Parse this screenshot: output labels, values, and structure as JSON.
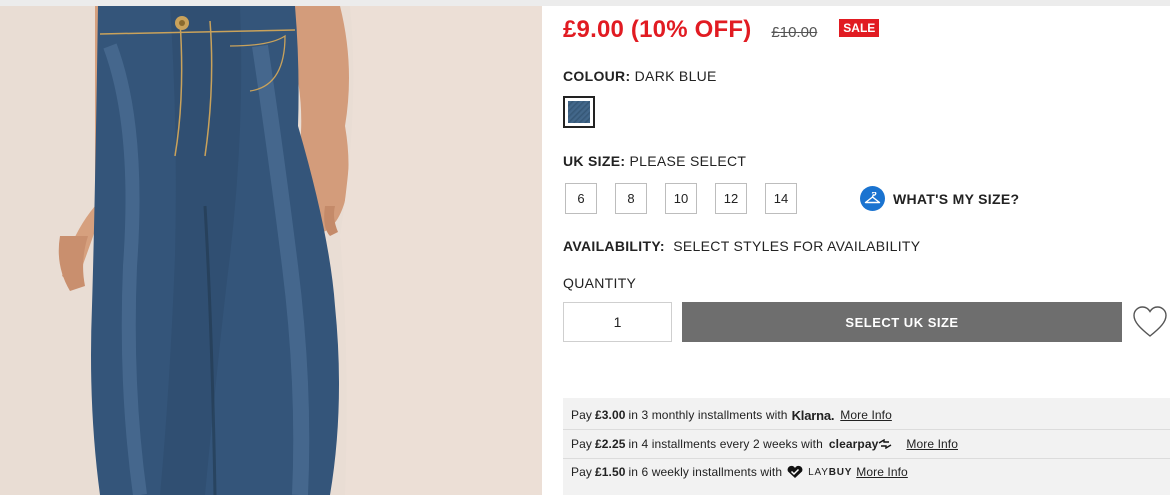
{
  "price": {
    "current": "£9.00 (10% OFF)",
    "original": "£10.00",
    "badge": "SALE"
  },
  "colour": {
    "label": "COLOUR:",
    "value": "DARK BLUE",
    "swatch_color": "#3b5e80"
  },
  "size": {
    "label": "UK SIZE:",
    "value": "PLEASE SELECT",
    "options": [
      "6",
      "8",
      "10",
      "12",
      "14"
    ],
    "guide_label": "WHAT'S MY SIZE?",
    "guide_icon": "hanger-icon"
  },
  "availability": {
    "label": "AVAILABILITY:",
    "value": "SELECT STYLES FOR AVAILABILITY"
  },
  "quantity": {
    "label": "QUANTITY",
    "value": "1"
  },
  "actions": {
    "select_size_label": "SELECT UK SIZE",
    "wishlist_icon": "heart-icon"
  },
  "payments": {
    "klarna": {
      "prefix": "Pay",
      "amount": "£3.00",
      "text": "in 3 monthly installments with",
      "logo": "Klarna.",
      "more": "More Info"
    },
    "clearpay": {
      "prefix": "Pay",
      "amount": "£2.25",
      "text": "in 4 installments every 2 weeks with",
      "logo": "clearpay",
      "more": "More Info"
    },
    "laybuy": {
      "prefix": "Pay",
      "amount": "£1.50",
      "text": "in 6 weekly installments with",
      "logo_light": "LAY",
      "logo_bold": "BUY",
      "more": "More Info"
    }
  },
  "colors": {
    "sale_red": "#e11b22",
    "button_grey": "#6e6e6e",
    "guide_blue": "#1a73d0"
  }
}
